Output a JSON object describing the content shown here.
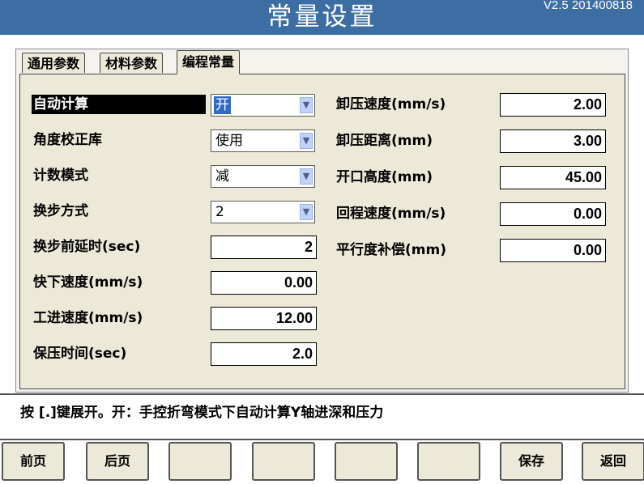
{
  "header": {
    "title": "常量设置",
    "version": "V2.5 201400818"
  },
  "tabs": [
    {
      "label": "通用参数"
    },
    {
      "label": "材料参数"
    },
    {
      "label": "编程常量"
    }
  ],
  "left": {
    "auto_calc": {
      "label": "自动计算",
      "value": "开"
    },
    "angle_lib": {
      "label": "角度校正库",
      "value": "使用"
    },
    "count_mode": {
      "label": "计数模式",
      "value": "减"
    },
    "step_mode": {
      "label": "换步方式",
      "value": "2"
    },
    "step_delay": {
      "label": "换步前延时(sec)",
      "value": "2"
    },
    "fast_down": {
      "label": "快下速度(mm/s)",
      "value": "0.00"
    },
    "work_speed": {
      "label": "工进速度(mm/s)",
      "value": "12.00"
    },
    "hold_time": {
      "label": "保压时间(sec)",
      "value": "2.0"
    }
  },
  "right": {
    "unload_speed": {
      "label": "卸压速度(mm/s)",
      "value": "2.00"
    },
    "unload_dist": {
      "label": "卸压距离(mm)",
      "value": "3.00"
    },
    "open_height": {
      "label": "开口高度(mm)",
      "value": "45.00"
    },
    "return_speed": {
      "label": "回程速度(mm/s)",
      "value": "0.00"
    },
    "parallel_comp": {
      "label": "平行度补偿(mm)",
      "value": "0.00"
    }
  },
  "hint": "按 [.]键展开。开：手控折弯模式下自动计算Y轴进深和压力",
  "buttons": [
    {
      "label": "前页"
    },
    {
      "label": "后页"
    },
    {
      "label": ""
    },
    {
      "label": ""
    },
    {
      "label": ""
    },
    {
      "label": ""
    },
    {
      "label": "保存"
    },
    {
      "label": "返回"
    }
  ]
}
